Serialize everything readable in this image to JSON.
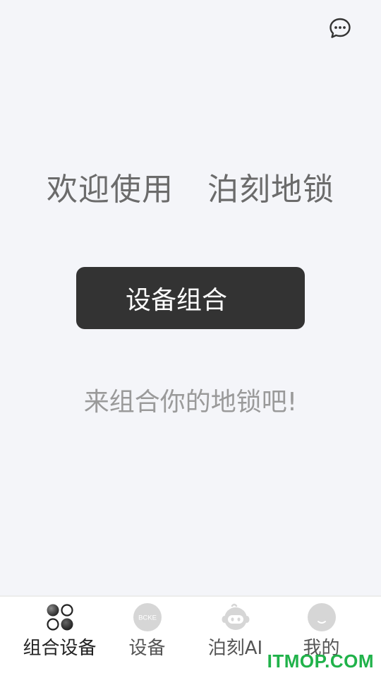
{
  "header": {
    "message_icon": "chat-bubble-icon"
  },
  "main": {
    "welcome_part1": "欢迎使用",
    "welcome_part2": "泊刻地锁",
    "combine_button_label": "设备组合",
    "hint": "来组合你的地锁吧!"
  },
  "tabbar": {
    "items": [
      {
        "label": "组合设备",
        "icon": "combine-devices-icon",
        "active": true
      },
      {
        "label": "设备",
        "icon": "bcke-device-icon",
        "badge_text": "BCKE"
      },
      {
        "label": "泊刻AI",
        "icon": "robot-ai-icon"
      },
      {
        "label": "我的",
        "icon": "profile-smile-icon"
      }
    ]
  },
  "watermark": "ITMOP.COM",
  "colors": {
    "background": "#f4f5f9",
    "button": "#333333",
    "watermark": "#20b24a"
  }
}
